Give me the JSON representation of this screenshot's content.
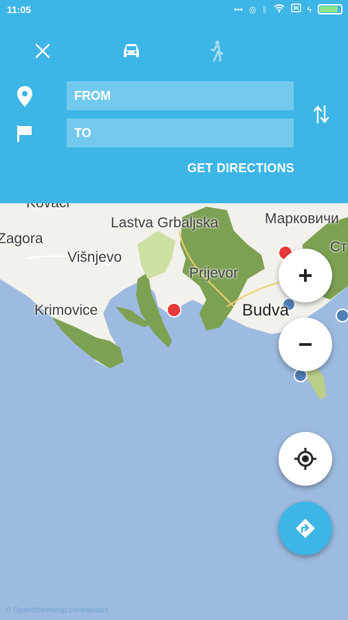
{
  "status_bar": {
    "time": "11:05",
    "icons": [
      "more-dots-icon",
      "sync-icon",
      "bluetooth-icon",
      "wifi-icon",
      "sim-icon",
      "charging-icon",
      "battery-icon"
    ]
  },
  "header": {
    "from_placeholder": "FROM",
    "to_placeholder": "TO",
    "get_directions_label": "GET DIRECTIONS",
    "accent_color": "#3db5e6"
  },
  "map": {
    "labels": {
      "kovaci": "Kovači",
      "lastva": "Lastva Grbaljska",
      "markovici": "Марковичи",
      "zagora": "Zagora",
      "visnjevo": "Višnjevo",
      "prijevor": "Prijevor",
      "krimovice": "Krimovice",
      "budva": "Budva",
      "st": "Ст"
    }
  },
  "controls": {
    "zoom_in_label": "+",
    "zoom_out_label": "−"
  },
  "footer": {
    "attribution": "© OpenStreetMap contributors"
  }
}
